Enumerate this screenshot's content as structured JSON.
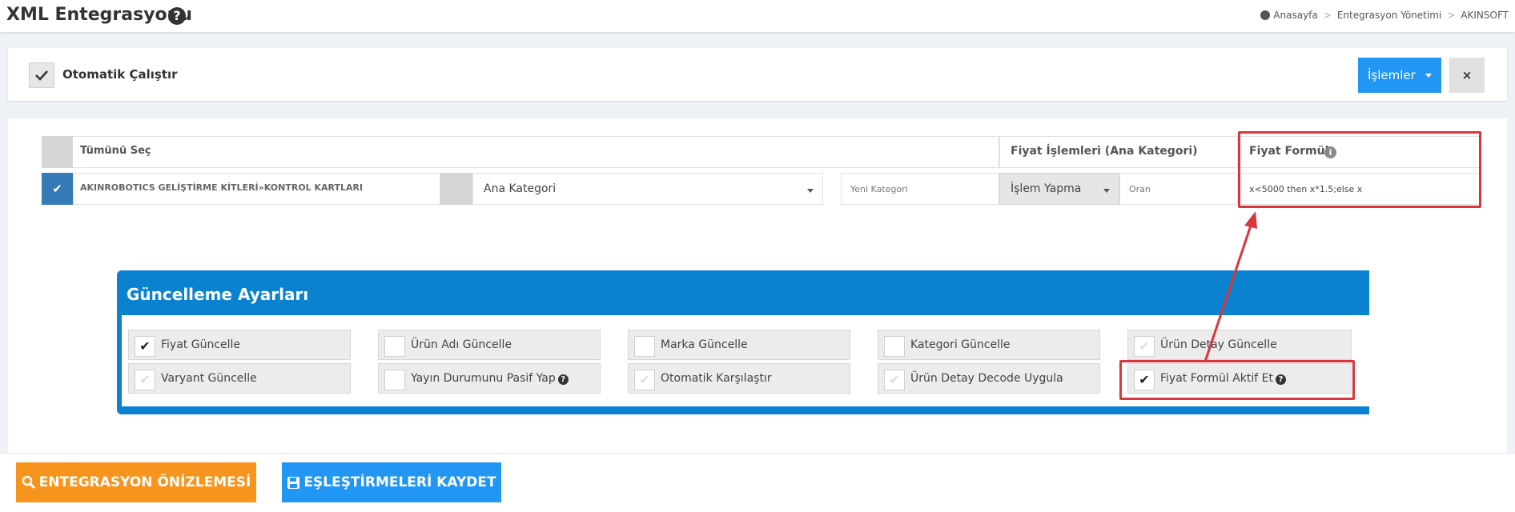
{
  "header": {
    "title": "XML Entegrasyonu",
    "help_icon": "?",
    "breadcrumb": [
      "Anasayfa",
      "Entegrasyon Yönetimi",
      "AKINSOFT"
    ]
  },
  "topbar": {
    "auto_run_label": "Otomatik Çalıştır",
    "auto_run_checked": true,
    "actions_label": "İşlemler",
    "close_label": "×"
  },
  "mapping": {
    "select_all_label": "Tümünü Seç",
    "price_ops_header": "Fiyat İşlemleri (Ana Kategori)",
    "formula_header": "Fiyat Formül",
    "row": {
      "category_name": "AKINROBOTICS GELİŞTİRME KİTLERİ»KONTROL KARTLARI",
      "checked": true,
      "main_category_select": "Ana Kategori",
      "new_category_placeholder": "Yeni Kategori",
      "operation_select": "İşlem Yapma",
      "ratio_placeholder": "Oran",
      "formula_value": "x<5000 then x*1.5;else x"
    }
  },
  "settings": {
    "title": "Güncelleme Ayarları",
    "options": [
      {
        "label": "Fiyat Güncelle",
        "checked": true
      },
      {
        "label": "Ürün Adı Güncelle",
        "checked": false
      },
      {
        "label": "Marka Güncelle",
        "checked": false
      },
      {
        "label": "Kategori Güncelle",
        "checked": false
      },
      {
        "label": "Ürün Detay Güncelle",
        "checked": false
      },
      {
        "label": "Varyant Güncelle",
        "checked": false
      },
      {
        "label": "Yayın Durumunu Pasif Yap",
        "checked": false
      },
      {
        "label": "Otomatik Karşılaştır",
        "checked": false
      },
      {
        "label": "Ürün Detay Decode Uygula",
        "checked": false
      },
      {
        "label": "Fiyat Formül Aktif Et",
        "checked": true
      }
    ]
  },
  "footer": {
    "preview_label": "ENTEGRASYON ÖNİZLEMESİ",
    "save_label": "EŞLEŞTİRMELERİ KAYDET"
  },
  "colors": {
    "accent_blue": "#2196f3",
    "panel_blue": "#0b82d0",
    "orange": "#f7941d",
    "highlight_red": "#d9363e"
  }
}
